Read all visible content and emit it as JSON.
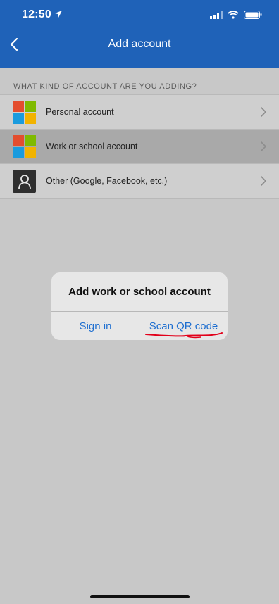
{
  "status_bar": {
    "time": "12:50",
    "icons": [
      "location-arrow-icon",
      "cellular-signal-icon",
      "wifi-icon",
      "battery-icon"
    ]
  },
  "nav": {
    "title": "Add account",
    "back_icon": "chevron-left-icon"
  },
  "section": {
    "header": "WHAT KIND OF ACCOUNT ARE YOU ADDING?"
  },
  "accounts": [
    {
      "label": "Personal account",
      "icon": "microsoft-logo-icon",
      "selected": false
    },
    {
      "label": "Work or school account",
      "icon": "microsoft-logo-icon",
      "selected": true
    },
    {
      "label": "Other (Google, Facebook, etc.)",
      "icon": "person-icon",
      "selected": false
    }
  ],
  "dialog": {
    "title": "Add work or school account",
    "sign_in_label": "Sign in",
    "scan_qr_label": "Scan QR code"
  },
  "colors": {
    "nav_blue": "#1f62b8",
    "link_blue": "#1f6fd0",
    "ms_red": "#f25022",
    "ms_green": "#7fba00",
    "ms_blue": "#00a4ef",
    "ms_yellow": "#ffb900",
    "annotation_red": "#e2001a"
  }
}
